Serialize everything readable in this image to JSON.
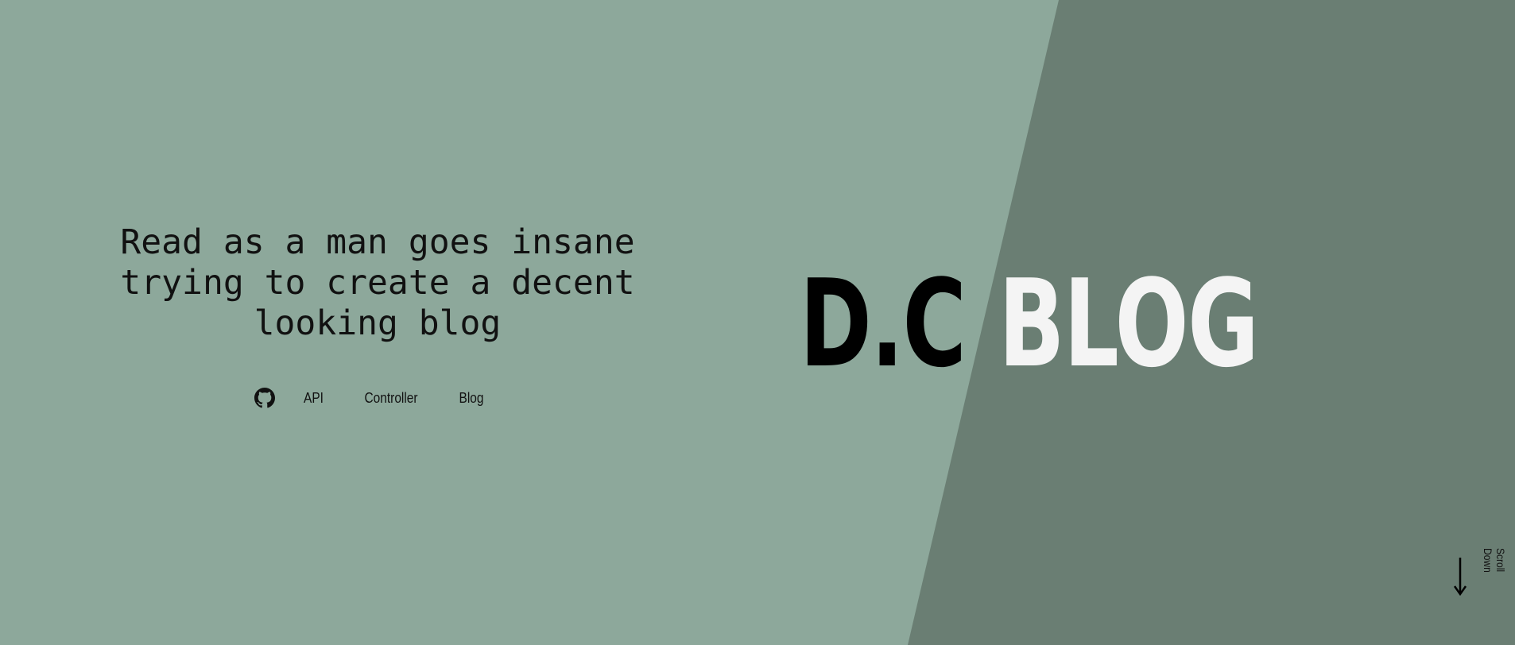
{
  "hero": {
    "tagline_line1": "Read as a man goes insane",
    "tagline_line2": "trying to create a decent",
    "tagline_line3": "looking blog",
    "brand_left": "D.C",
    "brand_right": "BLOG",
    "scroll_label": "Scroll Down"
  },
  "nav": {
    "github_icon": "github-icon",
    "links": [
      {
        "label": "API"
      },
      {
        "label": "Controller"
      },
      {
        "label": "Blog"
      }
    ]
  },
  "colors": {
    "background_light": "#8da89b",
    "background_dark": "#6a7e73",
    "brand_dark": "#000000",
    "brand_light": "#f4f4f4"
  }
}
